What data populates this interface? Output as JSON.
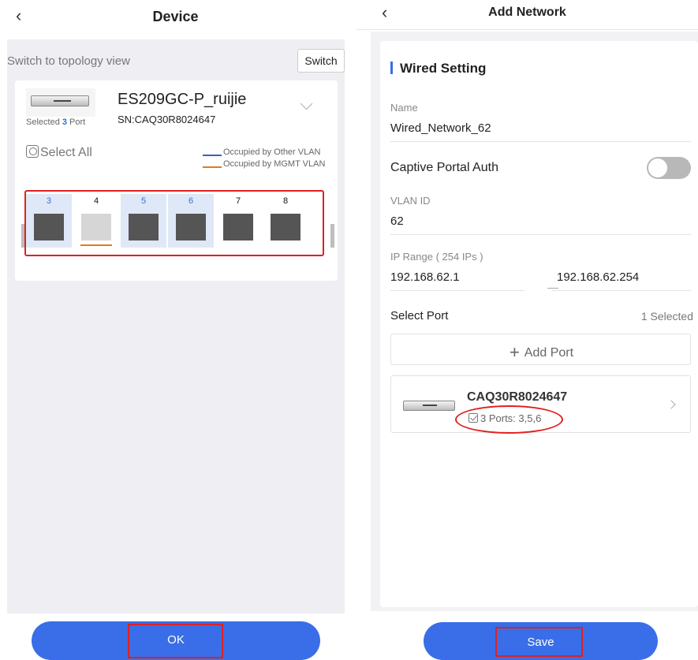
{
  "left": {
    "title": "Device",
    "topology_text": "Switch to topology view",
    "switch_label": "Switch",
    "device": {
      "name": "ES209GC-P_ruijie",
      "sn": "SN:CAQ30R8024647",
      "selected_prefix": "Selected ",
      "selected_count": "3",
      "selected_suffix": " Port"
    },
    "select_all": "Select All",
    "legend": [
      {
        "label": "Occupied by Other VLAN",
        "color": "#3a5fc8"
      },
      {
        "label": "Occupied by MGMT VLAN",
        "color": "#e07a1f"
      }
    ],
    "ports": [
      {
        "num": "3",
        "selected": true,
        "state": "active",
        "bar": ""
      },
      {
        "num": "4",
        "selected": false,
        "state": "inactive",
        "bar": "#e07a1f"
      },
      {
        "num": "5",
        "selected": true,
        "state": "active",
        "bar": ""
      },
      {
        "num": "6",
        "selected": true,
        "state": "active",
        "bar": ""
      },
      {
        "num": "7",
        "selected": false,
        "state": "active",
        "bar": ""
      },
      {
        "num": "8",
        "selected": false,
        "state": "active",
        "bar": ""
      }
    ],
    "ok_label": "OK"
  },
  "right": {
    "title": "Add Network",
    "section_title": "Wired Setting",
    "name_label": "Name",
    "name_value": "Wired_Network_62",
    "captive_label": "Captive Portal Auth",
    "captive_on": false,
    "vlan_label": "VLAN ID",
    "vlan_value": "62",
    "ip_label": "IP Range ( 254 IPs )",
    "ip_start": "192.168.62.1",
    "ip_end": "192.168.62.254",
    "select_port_label": "Select Port",
    "select_count": "1 Selected",
    "add_port_label": "Add Port",
    "port_card": {
      "sn": "CAQ30R8024647",
      "ports": "3 Ports: 3,5,6"
    },
    "save_label": "Save"
  },
  "colors": {
    "accent": "#3a6ee8",
    "highlight": "#e02020",
    "port_selected_bg": "#dfe8f7",
    "port_active": "#555555",
    "port_inactive": "#d6d6d6"
  }
}
